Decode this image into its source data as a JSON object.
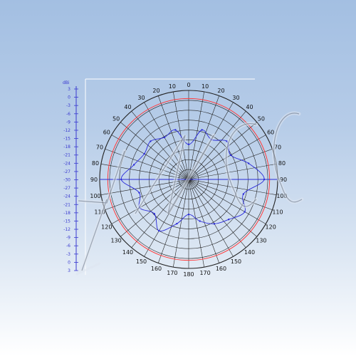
{
  "chart_data": {
    "type": "polar",
    "unit_label": "dBi",
    "angle_tick_labels": [
      "0",
      "10",
      "20",
      "30",
      "40",
      "50",
      "60",
      "70",
      "80",
      "90",
      "100",
      "110",
      "120",
      "130",
      "140",
      "150",
      "160",
      "170",
      "180",
      "170",
      "160",
      "150",
      "140",
      "130",
      "120",
      "110",
      "100",
      "90",
      "80",
      "70",
      "60",
      "50",
      "40",
      "30",
      "20",
      "10"
    ],
    "scale_tick_labels": [
      "3",
      "0",
      "-3",
      "-6",
      "-9",
      "-12",
      "-15",
      "-18",
      "-21",
      "-24",
      "-27",
      "-30",
      "-27",
      "-24",
      "-21",
      "-18",
      "-15",
      "-12",
      "-9",
      "-6",
      "-3",
      "0",
      "3"
    ],
    "radial_range_db": [
      -30,
      3
    ],
    "reference_ring_db": 0,
    "series": [
      {
        "type": "line",
        "angle_deg": [
          0,
          15,
          30,
          45,
          60,
          75,
          90,
          105,
          120,
          135,
          150,
          165,
          180,
          195,
          210,
          225,
          240,
          255,
          270,
          285,
          300,
          315,
          330,
          345
        ],
        "gain_db": [
          -17,
          -11,
          -13,
          -10,
          -12,
          -7,
          -2,
          -9,
          -6,
          -9,
          -11,
          -14,
          -17,
          -13,
          -8,
          -12,
          -9,
          -11,
          -5,
          -9,
          -11,
          -10,
          -12,
          -11
        ]
      }
    ],
    "colors": {
      "grid": "#222222",
      "reference_ring": "#ff3b3b",
      "trace": "#2a2ad8",
      "scale": "#3a3ad0"
    },
    "grid": true,
    "watermark": "logo"
  }
}
